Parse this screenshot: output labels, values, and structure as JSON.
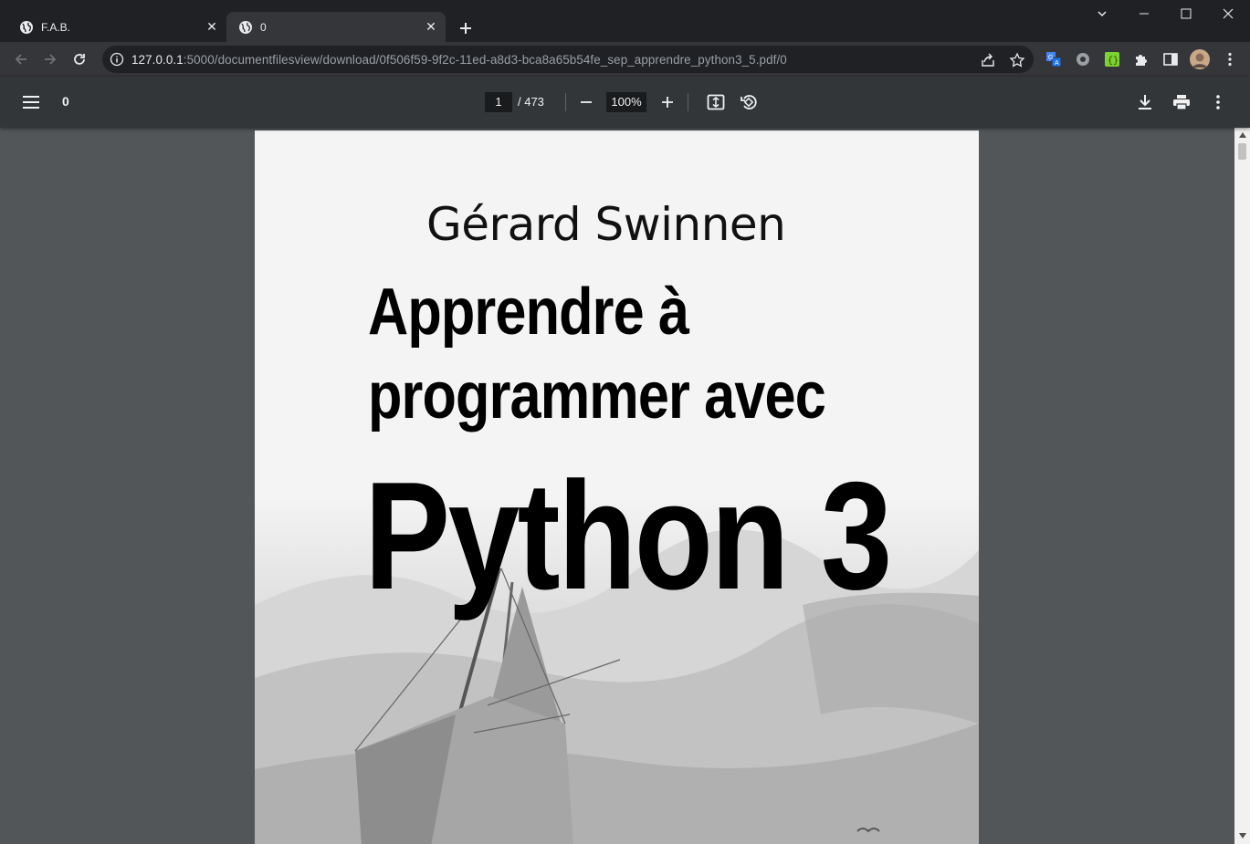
{
  "tabs": [
    {
      "title": "F.A.B.",
      "active": false
    },
    {
      "title": "0",
      "active": true
    }
  ],
  "toolbar": {
    "url_host": "127.0.0.1",
    "url_rest": ":5000/documentfilesview/download/0f506f59-9f2c-11ed-a8d3-bca8a65b54fe_sep_apprendre_python3_5.pdf/0"
  },
  "pdf": {
    "title": "0",
    "current_page": "1",
    "total_pages": "/ 473",
    "zoom": "100%"
  },
  "cover": {
    "author": "Gérard Swinnen",
    "title_line1": "Apprendre à",
    "title_line2": "programmer avec",
    "title_line3": "Python 3"
  },
  "colors": {
    "chrome_dark": "#202124",
    "chrome_toolbar": "#35363a",
    "pdf_toolbar": "#323639",
    "viewer_bg": "#525659"
  }
}
